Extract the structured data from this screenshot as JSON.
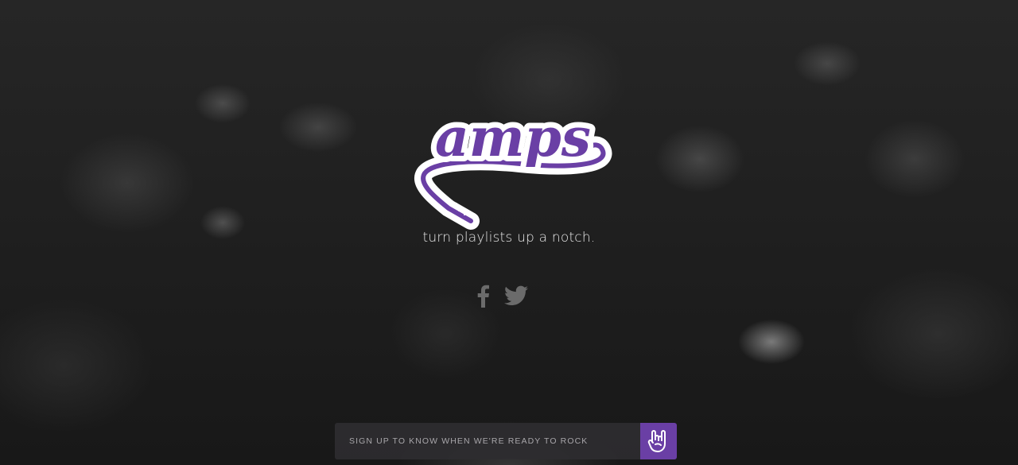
{
  "brand": {
    "logo_text": "amps",
    "tagline": "turn playlists up a notch.",
    "accent_color": "#6a3fa5"
  },
  "social": {
    "facebook_icon": "facebook-icon",
    "twitter_icon": "twitter-icon"
  },
  "signup": {
    "placeholder": "SIGN UP TO KNOW WHEN WE'RE READY TO ROCK",
    "submit_icon": "rock-hand-icon"
  }
}
